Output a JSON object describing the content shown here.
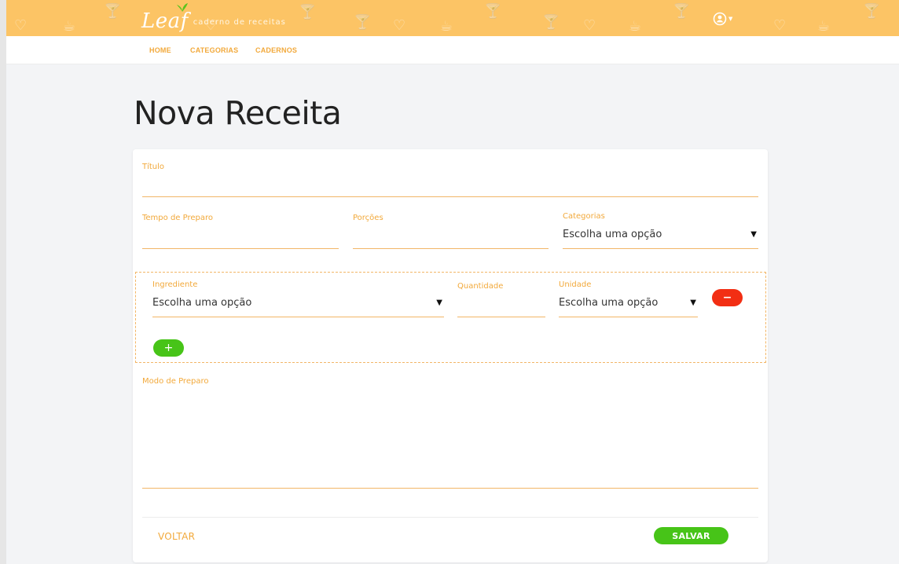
{
  "brand": {
    "logo": "Leaf",
    "tagline": "caderno de receitas"
  },
  "nav": {
    "items": [
      {
        "label": "HOME"
      },
      {
        "label": "CATEGORIAS"
      },
      {
        "label": "CADERNOS"
      }
    ]
  },
  "page": {
    "title": "Nova Receita"
  },
  "form": {
    "titulo": {
      "label": "Título",
      "value": ""
    },
    "tempo": {
      "label": "Tempo de Preparo",
      "value": ""
    },
    "porcoes": {
      "label": "Porções",
      "value": ""
    },
    "categorias": {
      "label": "Categorias",
      "selected": "Escolha uma opção"
    },
    "ingredients": [
      {
        "ingrediente": {
          "label": "Ingrediente",
          "selected": "Escolha uma opção"
        },
        "quantidade": {
          "label": "Quantidade",
          "value": ""
        },
        "unidade": {
          "label": "Unidade",
          "selected": "Escolha uma opção"
        },
        "remove_label": "−"
      }
    ],
    "add_label": "+",
    "modo": {
      "label": "Modo de Preparo",
      "value": ""
    }
  },
  "actions": {
    "back": "VOLTAR",
    "save": "SALVAR"
  },
  "icons": {
    "user": "user-circle-icon",
    "caret": "caret-down-icon",
    "leaf": "leaf-icon"
  },
  "colors": {
    "topbar": "#fcc465",
    "accent": "#f2a93b",
    "success": "#47c418",
    "danger": "#f22e13",
    "background": "#f3f4f6"
  }
}
